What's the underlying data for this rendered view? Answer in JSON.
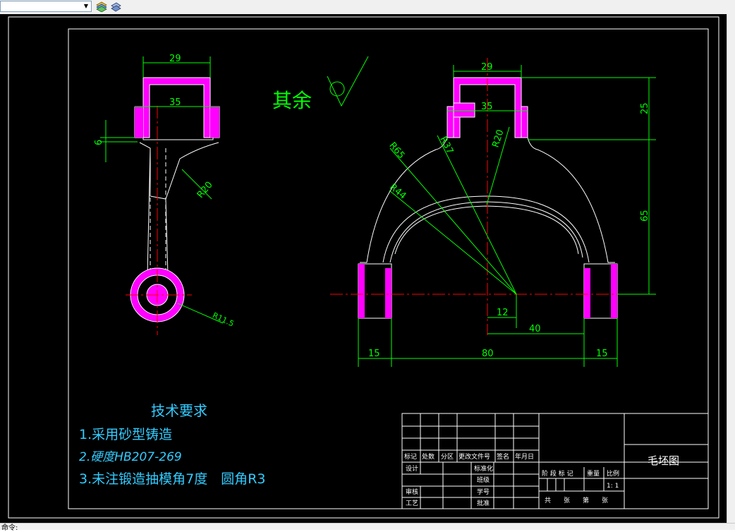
{
  "toolbar": {
    "layer_value": "",
    "icons": [
      "layer-stack-icon",
      "layer-properties-icon"
    ]
  },
  "drawing": {
    "roughness_label": "其余",
    "dims_left": {
      "top_width": "29",
      "inner_width": "35",
      "thickness": "6",
      "radius": "R20",
      "boss_radius": "R11.5"
    },
    "dims_right": {
      "top_width": "29",
      "inner_width": "35",
      "r65": "R65",
      "r37": "R37",
      "r20": "R20",
      "r44": "R44",
      "height_25": "25",
      "height_65": "65",
      "offset_12": "12",
      "offset_40": "40",
      "left_15": "15",
      "span_80": "80",
      "right_15": "15"
    },
    "requirements": {
      "title": "技术要求",
      "items": [
        "1.采用砂型铸造",
        "2.硬度HB207-269",
        "3.未注锻造抽模角7度　圆角R3"
      ]
    }
  },
  "title_block": {
    "header_cells": [
      "标记",
      "处数",
      "分区",
      "更改文件号",
      "签名",
      "年月日"
    ],
    "row_design": "设计",
    "row_review": "审核",
    "row_craft": "工艺",
    "standard": "标准化",
    "class": "班级",
    "student_no": "学号",
    "approve": "批准",
    "stage_header": [
      "阶 段 标 记",
      "重量",
      "比例"
    ],
    "scale": "1: 1",
    "sheets": "共　　张　　第　　张",
    "drawing_name": "毛坯图"
  },
  "status": {
    "text": "命令:"
  },
  "colors": {
    "background": "#000000",
    "outline": "#ffffff",
    "dimension": "#00ff00",
    "centerline": "#ff0000",
    "section": "#ff00ff",
    "text_cyan": "#33ccff"
  }
}
